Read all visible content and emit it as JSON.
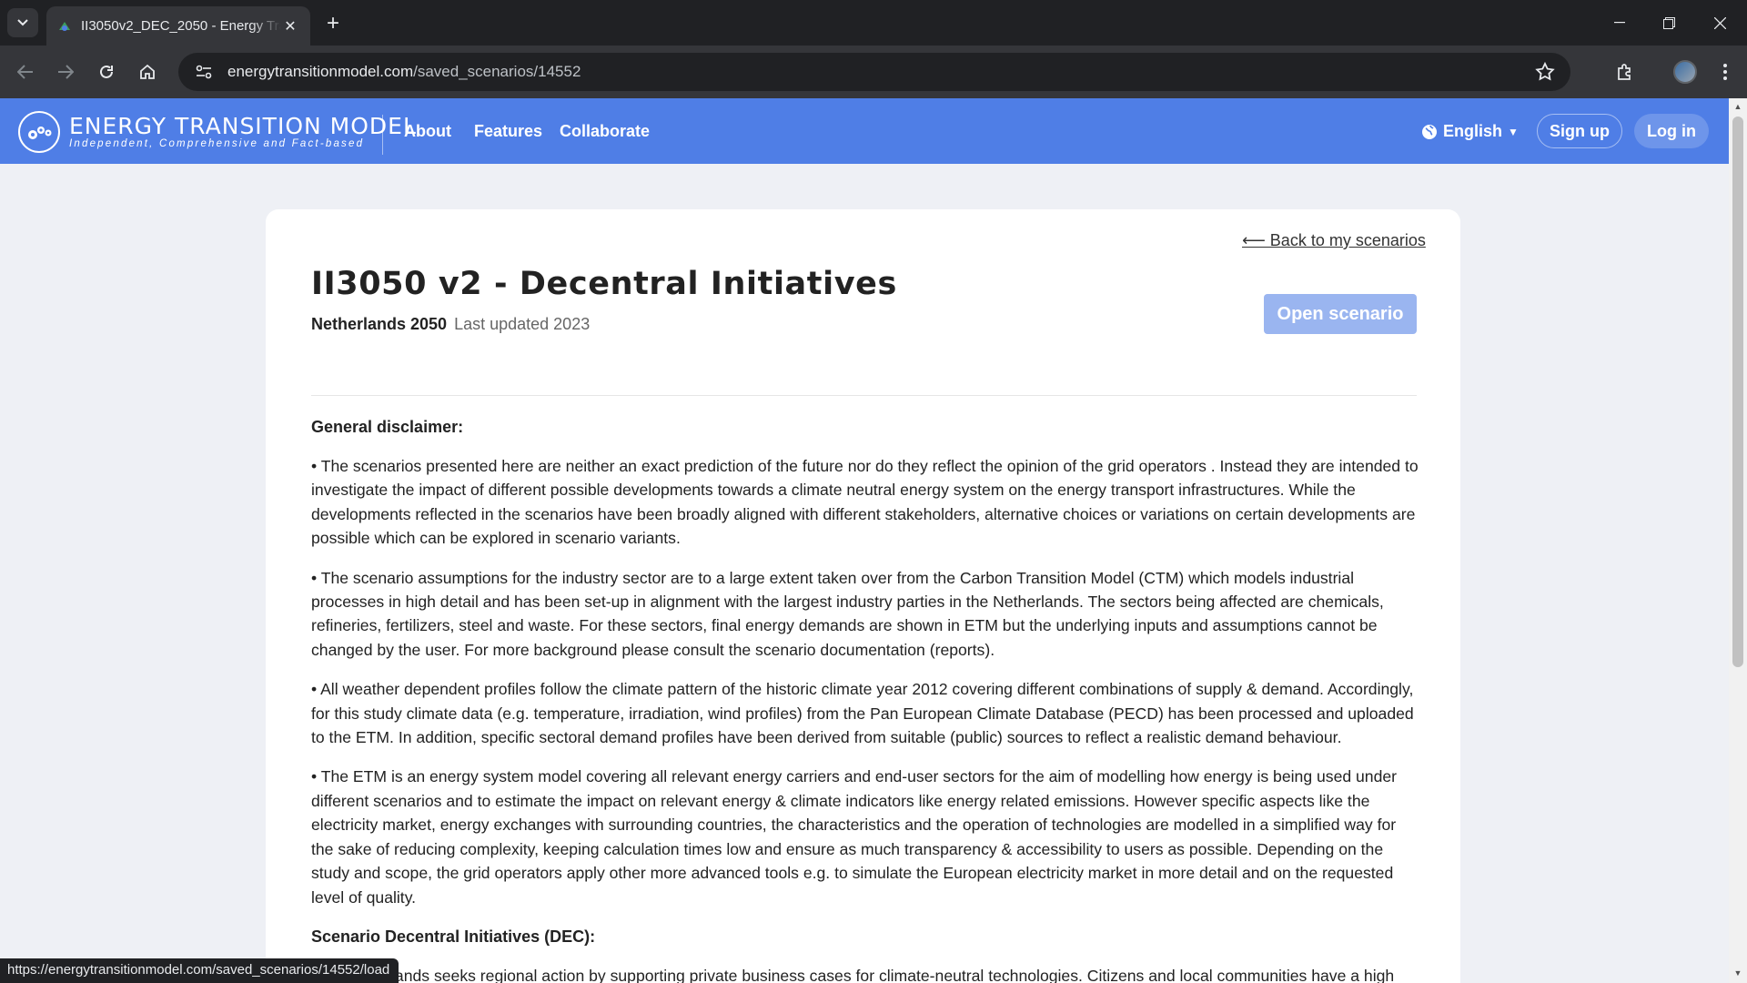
{
  "browser": {
    "tab_title": "II3050v2_DEC_2050 - Energy Transition Model",
    "url_host": "energytransitionmodel.com",
    "url_path": "/saved_scenarios/14552",
    "status_url": "https://energytransitionmodel.com/saved_scenarios/14552/load"
  },
  "header": {
    "logo_title": "ENERGY TRANSITION MODEL",
    "logo_subtitle": "Independent, Comprehensive and Fact-based",
    "nav": [
      "About",
      "Features",
      "Collaborate"
    ],
    "language": "English",
    "signup": "Sign up",
    "login": "Log in",
    "brand_color": "#4f7ee6"
  },
  "scenario": {
    "back_link": "⟵ Back to my scenarios",
    "title": "II3050 v2 - Decentral Initiatives",
    "region": "Netherlands 2050",
    "updated": "Last updated 2023",
    "open_button": "Open scenario"
  },
  "description": {
    "disclaimer_heading": "General disclaimer:",
    "paragraphs": [
      "• The scenarios presented here are neither an exact prediction of the future nor do they reflect the opinion of the grid operators . Instead they are intended to investigate the impact of different possible developments towards a climate neutral energy system on the energy transport infrastructures. While the developments reflected in the scenarios have been broadly aligned with different stakeholders, alternative choices or variations on certain developments are possible which can be explored in scenario variants.",
      "• The scenario assumptions for the industry sector are to a large extent taken over from the Carbon Transition Model (CTM) which models industrial processes in high detail and has been set-up in alignment with the largest industry parties in the Netherlands. The sectors being affected are chemicals, refineries, fertilizers, steel and waste. For these sectors, final energy demands are shown in ETM but the underlying inputs and assumptions cannot be changed by the user. For more background please consult the scenario documentation (reports).",
      "• All weather dependent profiles follow the climate pattern of the historic climate year 2012 covering different combinations of supply & demand. Accordingly, for this study climate data (e.g. temperature, irradiation, wind profiles) from the Pan European Climate Database (PECD) has been processed and uploaded to the ETM. In addition, specific sectoral demand profiles have been derived from suitable (public) sources to reflect a realistic demand behaviour.",
      "• The ETM is an energy system model covering all relevant energy carriers and end-user sectors for the aim of modelling how energy is being used under different scenarios and to estimate the impact on relevant energy & climate indicators like energy related emissions. However specific aspects like the electricity market, energy exchanges with surrounding countries, the characteristics and the operation of technologies are modelled in a simplified way for the sake of reducing complexity, keeping calculation times low and ensure as much transparency & accessibility to users as possible. Depending on the study and scope, the grid operators apply other more advanced tools e.g. to simulate the European electricity market in more detail and on the requested level of quality."
    ],
    "scenario_heading": "Scenario Decentral Initiatives (DEC):",
    "scenario_paragraph": "The Netherlands seeks regional action by supporting private business cases for climate-neutral technologies. Citizens and local communities have a high"
  }
}
